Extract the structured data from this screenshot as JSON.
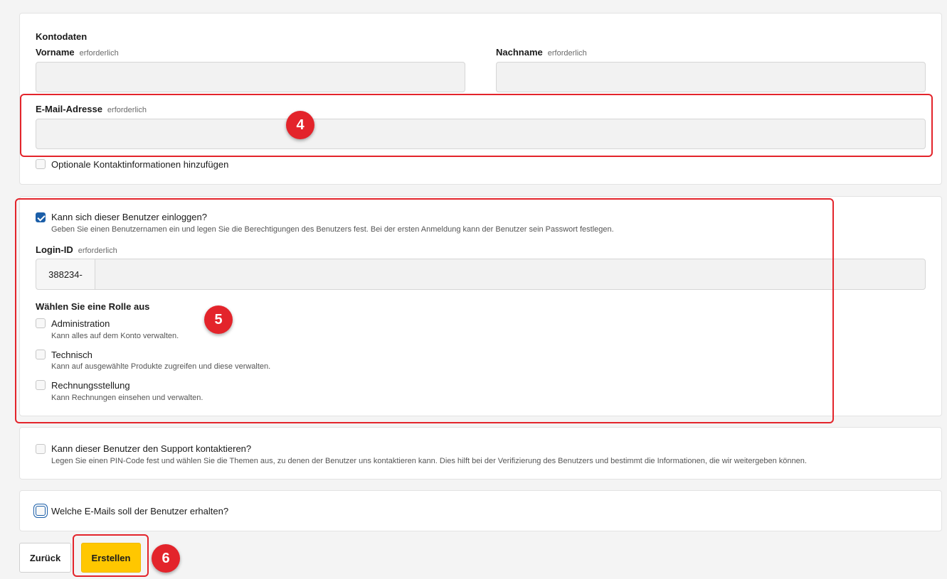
{
  "account": {
    "section_title": "Kontodaten",
    "first_name_label": "Vorname",
    "last_name_label": "Nachname",
    "email_label": "E-Mail-Adresse",
    "required": "erforderlich",
    "first_name_value": "",
    "last_name_value": "",
    "email_value": "",
    "optional_contact_label": "Optionale Kontaktinformationen hinzufügen",
    "optional_contact_checked": false
  },
  "login": {
    "can_login_label": "Kann sich dieser Benutzer einloggen?",
    "can_login_checked": true,
    "can_login_desc": "Geben Sie einen Benutzernamen ein und legen Sie die Berechtigungen des Benutzers fest. Bei der ersten Anmeldung kann der Benutzer sein Passwort festlegen.",
    "login_id_label": "Login-ID",
    "login_id_prefix": "388234-",
    "login_id_value": "",
    "role_heading": "Wählen Sie eine Rolle aus",
    "roles": [
      {
        "label": "Administration",
        "desc": "Kann alles auf dem Konto verwalten.",
        "checked": false
      },
      {
        "label": "Technisch",
        "desc": "Kann auf ausgewählte Produkte zugreifen und diese verwalten.",
        "checked": false
      },
      {
        "label": "Rechnungsstellung",
        "desc": "Kann Rechnungen einsehen und verwalten.",
        "checked": false
      }
    ]
  },
  "support": {
    "label": "Kann dieser Benutzer den Support kontaktieren?",
    "desc": "Legen Sie einen PIN-Code fest und wählen Sie die Themen aus, zu denen der Benutzer uns kontaktieren kann. Dies hilft bei der Verifizierung des Benutzers und bestimmt die Informationen, die wir weitergeben können.",
    "checked": false
  },
  "emails": {
    "label": "Welche E-Mails soll der Benutzer erhalten?",
    "checked": false
  },
  "buttons": {
    "back": "Zurück",
    "create": "Erstellen"
  },
  "annotations": {
    "badge_4": "4",
    "badge_5": "5",
    "badge_6": "6",
    "color": "#e3242b"
  },
  "colors": {
    "primary_button": "#ffc700",
    "checkbox_checked": "#1b5ea8",
    "page_bg": "#f4f4f4"
  }
}
